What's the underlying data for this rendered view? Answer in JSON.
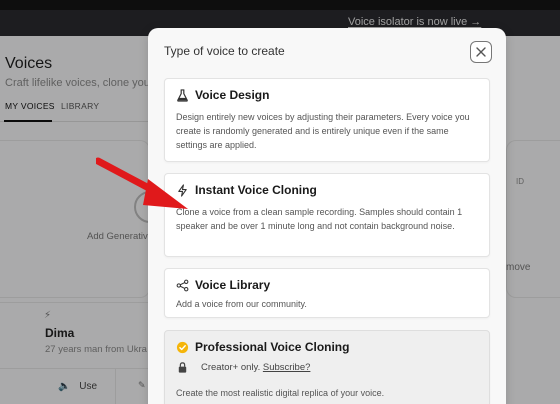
{
  "banner": {
    "text": "Voice isolator is now live  →"
  },
  "background": {
    "title": "Voices",
    "subtitle": "Craft lifelike voices, clone your",
    "tabs": [
      "MY VOICES",
      "LIBRARY"
    ],
    "add_generative": "Add Generativ",
    "voice_card": {
      "name": "Dima",
      "description": "27 years man from Ukra",
      "use_label": "Use"
    },
    "right_card": {
      "id_text": "ID",
      "remove_text": "move"
    }
  },
  "modal": {
    "title": "Type of voice to create",
    "options": [
      {
        "title": "Voice Design",
        "icon": "flask-icon",
        "description": "Design entirely new voices by adjusting their parameters. Every voice you create is randomly generated and is entirely unique even if the same settings are applied."
      },
      {
        "title": "Instant Voice Cloning",
        "icon": "lightning-icon",
        "description": "Clone a voice from a clean sample recording. Samples should contain 1 speaker and be over 1 minute long and not contain background noise."
      },
      {
        "title": "Voice Library",
        "icon": "share-icon",
        "description": "Add a voice from our community."
      },
      {
        "title": "Professional Voice Cloning",
        "icon": "verified-badge-icon",
        "creator_text": "Creator+ only.",
        "subscribe_label": "Subscribe?",
        "description": "Create the most realistic digital replica of your voice."
      }
    ]
  },
  "colors": {
    "annotation_arrow": "#e0191b",
    "pro_badge": "#f5b50a"
  }
}
